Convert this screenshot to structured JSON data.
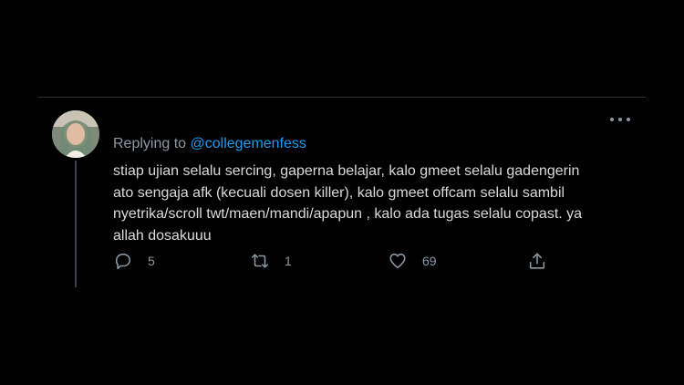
{
  "tweet": {
    "replying_prefix": "Replying to ",
    "replying_to": "@collegemenfess",
    "text": "stiap ujian selalu sercing, gaperna belajar, kalo gmeet selalu gadengerin\nato sengaja afk (kecuali dosen killer), kalo gmeet offcam selalu sambil\nnyetrika/scroll twt/maen/mandi/apapun , kalo ada tugas selalu copast. ya\nallah dosakuuu",
    "actions": {
      "reply_count": "5",
      "retweet_count": "1",
      "like_count": "69"
    }
  },
  "icons": {
    "more": "more-horizontal-icon",
    "reply": "reply-bubble-icon",
    "retweet": "retweet-icon",
    "like": "heart-icon",
    "share": "share-icon"
  },
  "colors": {
    "background": "#000000",
    "text": "#d9d9d9",
    "secondary": "#8b98a5",
    "mention": "#1d9bf0",
    "divider": "#2f3336"
  }
}
